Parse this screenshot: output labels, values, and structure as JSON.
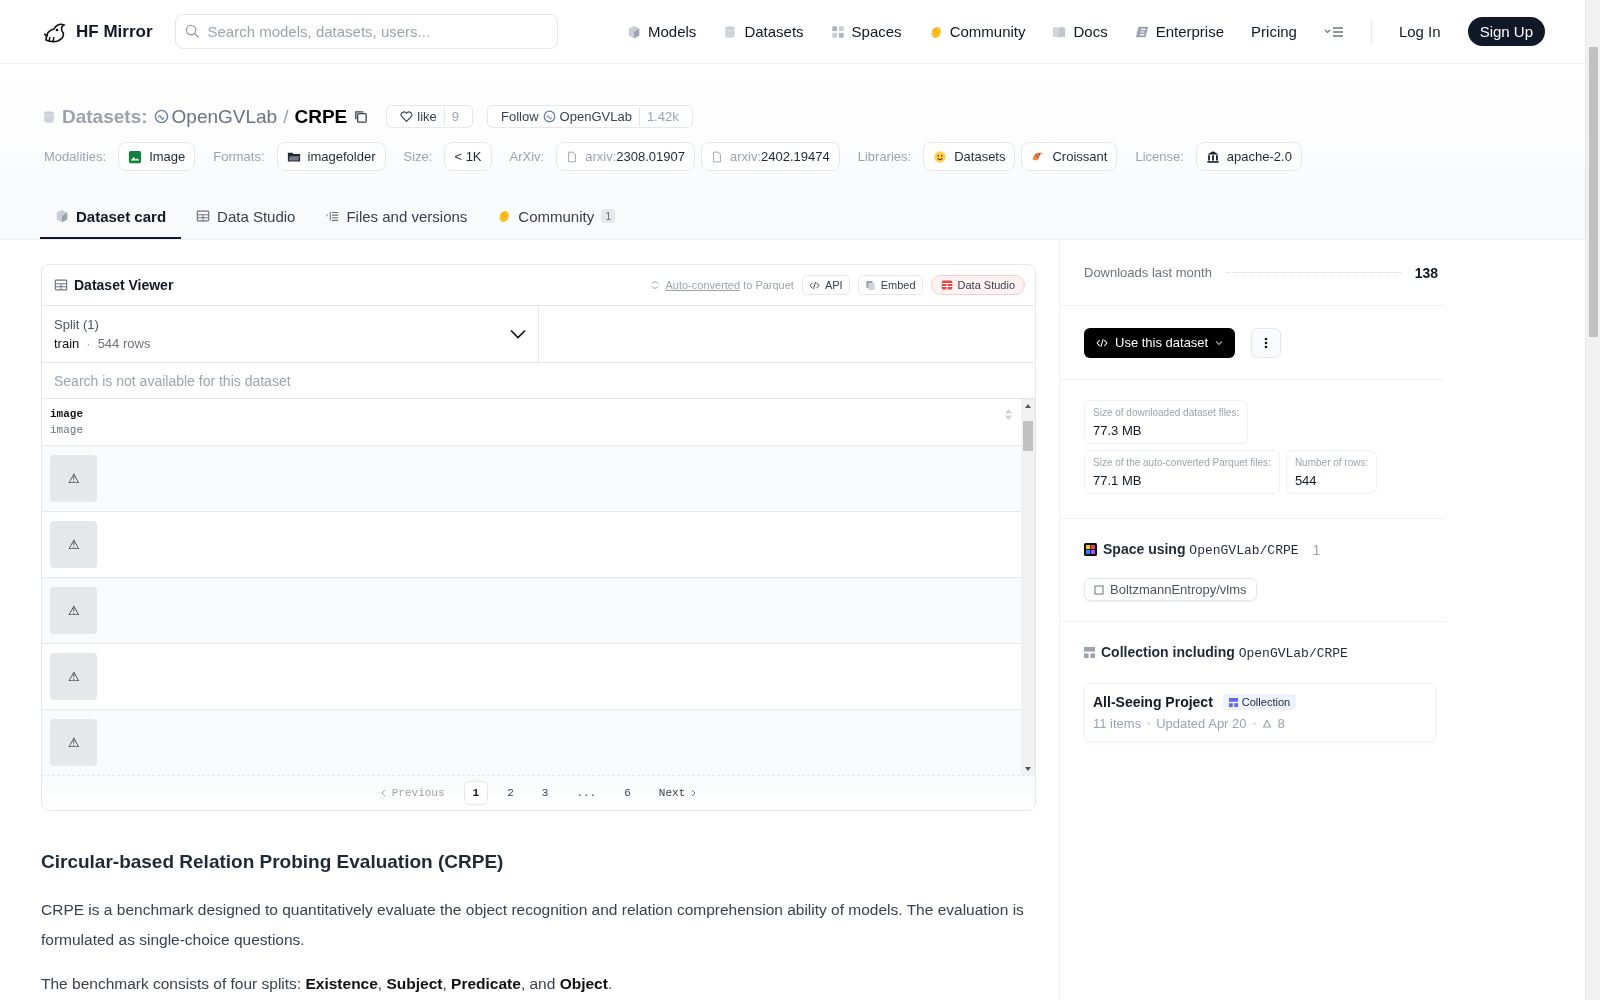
{
  "nav": {
    "brand": "HF Mirror",
    "search": {
      "placeholder": "Search models, datasets, users..."
    },
    "links": [
      {
        "label": "Models"
      },
      {
        "label": "Datasets"
      },
      {
        "label": "Spaces"
      },
      {
        "label": "Community"
      },
      {
        "label": "Docs"
      },
      {
        "label": "Enterprise"
      },
      {
        "label": "Pricing"
      }
    ],
    "log_in": "Log In",
    "sign_up": "Sign Up"
  },
  "header": {
    "section": "Datasets:",
    "owner": "OpenGVLab",
    "separator": "/",
    "name": "CRPE",
    "like": {
      "label": "like",
      "count": "9"
    },
    "follow": {
      "label": "Follow",
      "org": "OpenGVLab",
      "count": "1.42k"
    },
    "tag_groups": [
      {
        "label": "Modalities:",
        "tags": [
          {
            "text": "Image"
          }
        ]
      },
      {
        "label": "Formats:",
        "tags": [
          {
            "text": "imagefolder"
          }
        ]
      },
      {
        "label": "Size:",
        "tags": [
          {
            "text": "< 1K"
          }
        ]
      },
      {
        "label": "ArXiv:",
        "tags": [
          {
            "prefix": "arxiv:",
            "text": "2308.01907"
          },
          {
            "prefix": "arxiv:",
            "text": "2402.19474"
          }
        ]
      },
      {
        "label": "Libraries:",
        "tags": [
          {
            "text": "Datasets"
          },
          {
            "text": "Croissant"
          }
        ]
      },
      {
        "label": "License:",
        "tags": [
          {
            "text": "apache-2.0"
          }
        ]
      }
    ]
  },
  "tabs": [
    {
      "label": "Dataset card",
      "selected": true
    },
    {
      "label": "Data Studio",
      "selected": false
    },
    {
      "label": "Files and versions",
      "selected": false
    },
    {
      "label": "Community",
      "selected": false,
      "badge": "1"
    }
  ],
  "viewer": {
    "title": "Dataset Viewer",
    "converted_link": "Auto-converted",
    "converted_suffix": "to Parquet",
    "buttons": [
      "API",
      "Embed",
      "Data Studio"
    ],
    "split": {
      "label": "Split (1)",
      "value": "train",
      "separator": "·",
      "rows": "544 rows"
    },
    "search": {
      "placeholder": "Search is not available for this dataset"
    },
    "column": {
      "name": "image",
      "type": "image"
    },
    "rows": [
      {
        "image": "⚠"
      },
      {
        "image": "⚠"
      },
      {
        "image": "⚠"
      },
      {
        "image": "⚠"
      },
      {
        "image": "⚠"
      }
    ],
    "pagination": {
      "previous": "Previous",
      "pages": [
        {
          "label": "1",
          "selected": true
        },
        {
          "label": "2",
          "selected": false
        },
        {
          "label": "3",
          "selected": false
        },
        {
          "label": "...",
          "selected": false
        },
        {
          "label": "6",
          "selected": false
        }
      ],
      "next": "Next"
    }
  },
  "article": {
    "heading": "Circular-based Relation Probing Evaluation (CRPE)",
    "paragraphs": [
      "CRPE is a benchmark designed to quantitatively evaluate the object recognition and relation comprehension ability of models. The evaluation is formulated as single-choice questions.",
      "The benchmark consists of four splits: **Existence**, **Subject**, **Predicate**, and **Object**."
    ]
  },
  "sidebar": {
    "downloads": {
      "label": "Downloads last month",
      "value": "138"
    },
    "use_button": "Use this dataset",
    "stats": [
      [
        {
          "label": "Size of downloaded dataset files:",
          "value": "77.3 MB"
        }
      ],
      [
        {
          "label": "Size of the auto-converted Parquet files:",
          "value": "77.1 MB"
        },
        {
          "label": "Number of rows:",
          "value": "544"
        }
      ]
    ],
    "spaces": {
      "title": "Space using",
      "repo": "OpenGVLab/CRPE",
      "count": "1",
      "items": [
        "BoltzmannEntropy/vlms"
      ]
    },
    "collections": {
      "title": "Collection including",
      "repo": "OpenGVLab/CRPE",
      "items": [
        {
          "name": "All-Seeing Project",
          "badge": "Collection",
          "items": "11 items",
          "updated": "Updated Apr 20",
          "upvotes": "8"
        }
      ]
    }
  }
}
